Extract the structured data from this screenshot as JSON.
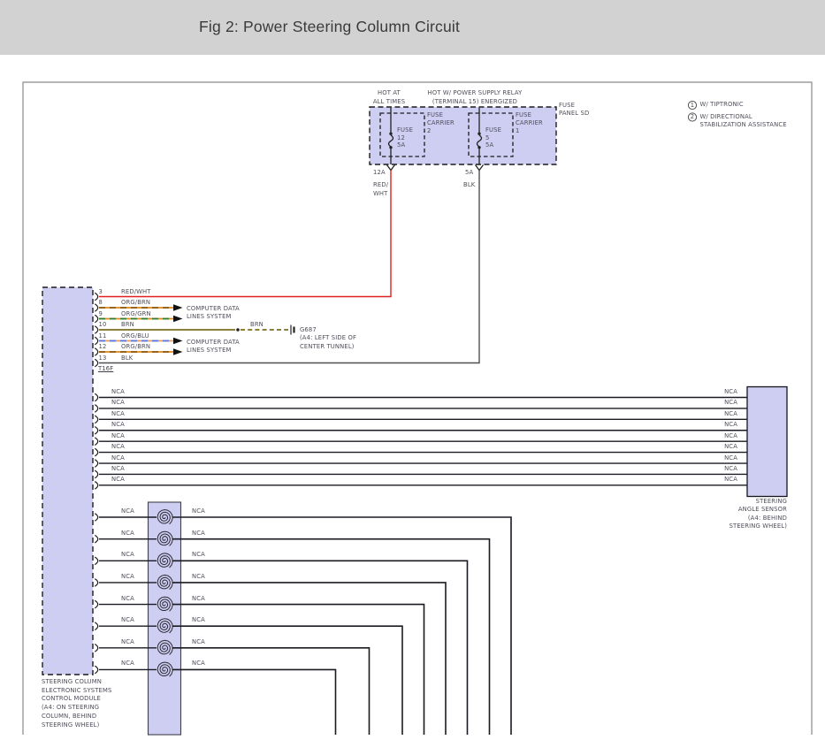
{
  "header": {
    "title": "Fig 2: Power Steering Column Circuit"
  },
  "notes": [
    {
      "num": "1",
      "lines": [
        "W/ TIPTRONIC"
      ]
    },
    {
      "num": "2",
      "lines": [
        "W/ DIRECTIONAL",
        "STABILIZATION ASSISTANCE"
      ]
    }
  ],
  "fuse_panel": {
    "supply_left": [
      "HOT AT",
      "ALL TIMES"
    ],
    "supply_right": [
      "HOT W/ POWER SUPPLY RELAY",
      "(TERMINAL 15) ENERGIZED"
    ],
    "panel_name": [
      "FUSE",
      "PANEL SD"
    ],
    "fuses": [
      {
        "carrier": [
          "FUSE",
          "CARRIER",
          "2"
        ],
        "fuse": [
          "FUSE",
          "12",
          "5A"
        ],
        "terminal": "12A",
        "wire": [
          "RED/",
          "WHT"
        ],
        "wire_color": "#e02020"
      },
      {
        "carrier": [
          "FUSE",
          "CARRIER",
          "1"
        ],
        "fuse": [
          "FUSE",
          "5",
          "5A"
        ],
        "terminal": "5A",
        "wire": [
          "BLK",
          ""
        ],
        "wire_color": "#4f4f4f"
      }
    ]
  },
  "module": {
    "connector": "T16F",
    "pins": [
      {
        "pin": "3",
        "wire": "RED/WHT",
        "base": "#e02020",
        "stripe": ""
      },
      {
        "pin": "8",
        "wire": "ORG/BRN",
        "base": "#e8860f",
        "stripe": "#8a5a1a"
      },
      {
        "pin": "9",
        "wire": "ORG/GRN",
        "base": "#e8860f",
        "stripe": "#2e7d2e"
      },
      {
        "pin": "10",
        "wire": "BRN",
        "base": "#7c6d1d",
        "stripe": ""
      },
      {
        "pin": "11",
        "wire": "ORG/BLU",
        "base": "#ee9955",
        "stripe": "#5577dd"
      },
      {
        "pin": "12",
        "wire": "ORG/BRN",
        "base": "#e8860f",
        "stripe": "#8a5a1a"
      },
      {
        "pin": "13",
        "wire": "BLK",
        "base": "#4f4f4f",
        "stripe": ""
      }
    ],
    "caption": [
      "STEERING COLUMN",
      "ELECTRONIC SYSTEMS",
      "CONTROL MODULE",
      "(A4: ON STEERING",
      "COLUMN, BEHIND",
      "STEERING WHEEL)"
    ]
  },
  "data_bus": {
    "label": [
      "COMPUTER DATA",
      "LINES SYSTEM"
    ]
  },
  "ground": {
    "wire": "BRN",
    "name": "G687",
    "location": [
      "(A4: LEFT SIDE OF",
      "CENTER TUNNEL)"
    ]
  },
  "angle_sensor": {
    "rows": [
      "NCA",
      "NCA",
      "NCA",
      "NCA",
      "NCA",
      "NCA",
      "NCA",
      "NCA",
      "NCA"
    ],
    "caption": [
      "STEERING",
      "ANGLE SENSOR",
      "(A4: BEHIND",
      "STEERING WHEEL)"
    ]
  },
  "clockspring": {
    "rows": [
      {
        "left": "NCA",
        "right": "NCA"
      },
      {
        "left": "NCA",
        "right": "NCA"
      },
      {
        "left": "NCA",
        "right": "NCA"
      },
      {
        "left": "NCA",
        "right": "NCA"
      },
      {
        "left": "NCA",
        "right": "NCA"
      },
      {
        "left": "NCA",
        "right": "NCA"
      },
      {
        "left": "NCA",
        "right": "NCA"
      },
      {
        "left": "NCA",
        "right": "NCA"
      }
    ]
  },
  "colors": {
    "component_fill": "#cecdf2",
    "line": "#1a1a22",
    "label": "#4e4e5a"
  }
}
